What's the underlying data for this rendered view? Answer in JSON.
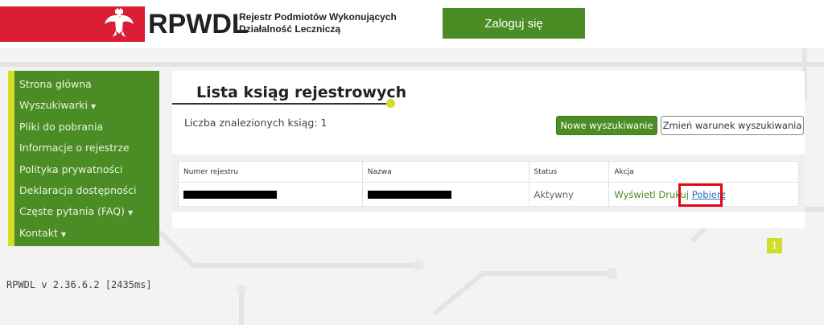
{
  "header": {
    "brand": "RPWDL",
    "subtitle_line1": "Rejestr Podmiotów Wykonujących",
    "subtitle_line2": "Działalność Leczniczą",
    "login_label": "Zaloguj się"
  },
  "sidebar": {
    "items": [
      {
        "label": "Strona główna",
        "dropdown": false
      },
      {
        "label": "Wyszukiwarki",
        "dropdown": true
      },
      {
        "label": "Pliki do pobrania",
        "dropdown": false
      },
      {
        "label": "Informacje o rejestrze",
        "dropdown": false
      },
      {
        "label": "Polityka prywatności",
        "dropdown": false
      },
      {
        "label": "Deklaracja dostępności",
        "dropdown": false
      },
      {
        "label": "Częste pytania (FAQ)",
        "dropdown": true
      },
      {
        "label": "Kontakt",
        "dropdown": true
      }
    ]
  },
  "main": {
    "title": "Lista ksiąg rejestrowych",
    "count_label": "Liczba znalezionych ksiąg: 1",
    "new_search_label": "Nowe wyszukiwanie",
    "change_condition_label": "Zmień warunek wyszukiwania",
    "table": {
      "headers": [
        "Numer rejestru",
        "Nazwa",
        "Status",
        "Akcja"
      ],
      "rows": [
        {
          "status": "Aktywny",
          "action_view": "Wyświetl",
          "action_print": "Drukuj",
          "action_download": "Pobierz"
        }
      ]
    }
  },
  "pagination": {
    "current_page": "1"
  },
  "footer": {
    "version": "RPWDL v 2.36.6.2 [2435ms]"
  },
  "colors": {
    "brand_green": "#4b8d24",
    "accent_yellow": "#d1dc2b",
    "header_red": "#dc1e35",
    "highlight_red": "#e0061a"
  }
}
